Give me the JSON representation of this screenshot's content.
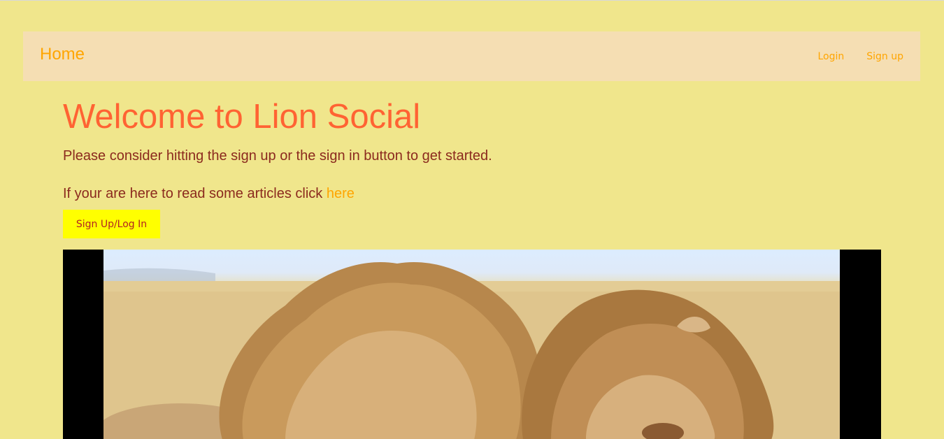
{
  "navbar": {
    "brand": "Home",
    "links": [
      {
        "label": "Login"
      },
      {
        "label": "Sign up"
      }
    ]
  },
  "main": {
    "headline": "Welcome to Lion Social",
    "intro": "Please consider hitting the sign up or the sign in button to get started.",
    "articles_prefix": "If your are here to read some articles click ",
    "articles_link": "here",
    "cta_label": "Sign Up/Log In"
  },
  "colors": {
    "background": "#f0e68c",
    "navbar": "#f5deb3",
    "accent": "#ffa500",
    "headline": "#ff6333",
    "body_text": "#8b2a1e",
    "button": "#ffff00"
  }
}
